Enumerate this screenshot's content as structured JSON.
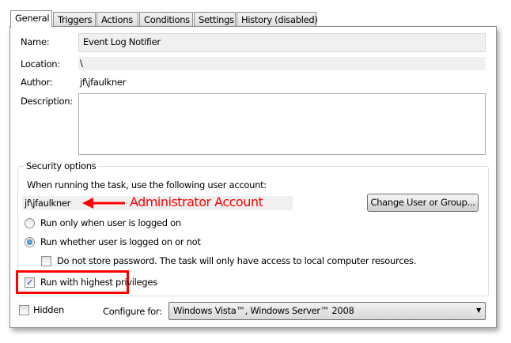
{
  "tabs": [
    "General",
    "Triggers",
    "Actions",
    "Conditions",
    "Settings",
    "History (disabled)"
  ],
  "general": {
    "name_label": "Name:",
    "name_value": "Event Log Notifier",
    "location_label": "Location:",
    "location_value": "\\",
    "author_label": "Author:",
    "author_value": "jf\\jfaulkner",
    "description_label": "Description:",
    "description_value": ""
  },
  "security": {
    "group_label": "Security options",
    "account_prompt": "When running the task, use the following user account:",
    "account_value": "jf\\jfaulkner",
    "annotation": "Administrator Account",
    "change_button": "Change User or Group...",
    "radio_logged_on": "Run only when user is logged on",
    "radio_whether": "Run whether user is logged on or not",
    "radio_selected": "Run whether user is logged on or not",
    "no_store_password": "Do not store password.  The task will only have access to local computer resources.",
    "no_store_password_checked": false,
    "highest_privileges": "Run with highest privileges",
    "highest_privileges_checked": true
  },
  "bottom": {
    "hidden_label": "Hidden",
    "hidden_checked": false,
    "configure_label": "Configure for:",
    "configure_value": "Windows Vista™, Windows Server™ 2008"
  },
  "colors": {
    "annotation": "#ff0000"
  }
}
